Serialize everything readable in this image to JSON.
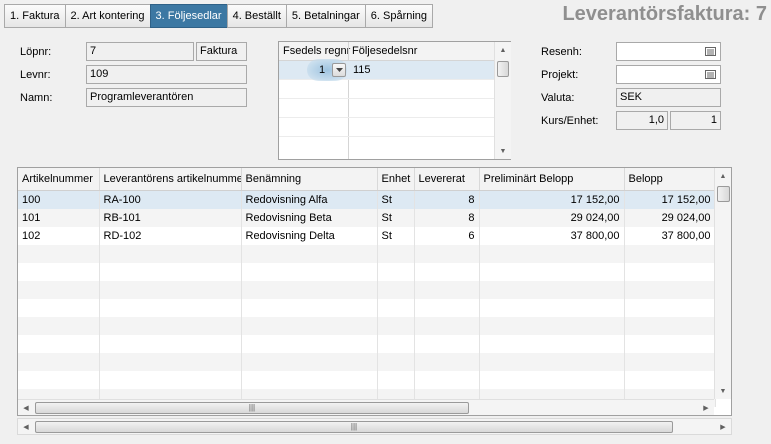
{
  "tabs": [
    {
      "label": "1. Faktura",
      "active": false
    },
    {
      "label": "2. Art kontering",
      "active": false
    },
    {
      "label": "3. Följesedlar",
      "active": true
    },
    {
      "label": "4. Beställt",
      "active": false
    },
    {
      "label": "5. Betalningar",
      "active": false
    },
    {
      "label": "6. Spårning",
      "active": false
    }
  ],
  "page_title": "Leverantörsfaktura: 7",
  "left_form": {
    "lopnr_label": "Löpnr:",
    "lopnr_value": "7",
    "type_value": "Faktura",
    "levnr_label": "Levnr:",
    "levnr_value": "109",
    "namn_label": "Namn:",
    "namn_value": "Programleverantören"
  },
  "delivery_grid": {
    "headers": [
      "Fsedels regnr",
      "Följesedelsnr"
    ],
    "rows": [
      {
        "regnr": "1",
        "number": "115"
      }
    ]
  },
  "right_form": {
    "resenh_label": "Resenh:",
    "resenh_value": "",
    "projekt_label": "Projekt:",
    "projekt_value": "",
    "valuta_label": "Valuta:",
    "valuta_value": "SEK",
    "kurs_label": "Kurs/Enhet:",
    "kurs_value": "1,0",
    "enhet_value": "1"
  },
  "items_grid": {
    "headers": [
      "Artikelnummer",
      "Leverantörens artikelnummer",
      "Benämning",
      "Enhet",
      "Levererat",
      "Preliminärt Belopp",
      "Belopp"
    ],
    "rows": [
      {
        "article": "100",
        "supplier_article": "RA-100",
        "name": "Redovisning Alfa",
        "unit": "St",
        "delivered": "8",
        "prelim": "17 152,00",
        "amount": "17 152,00"
      },
      {
        "article": "101",
        "supplier_article": "RB-101",
        "name": "Redovisning Beta",
        "unit": "St",
        "delivered": "8",
        "prelim": "29 024,00",
        "amount": "29 024,00"
      },
      {
        "article": "102",
        "supplier_article": "RD-102",
        "name": "Redovisning Delta",
        "unit": "St",
        "delivered": "6",
        "prelim": "37 800,00",
        "amount": "37 800,00"
      }
    ]
  },
  "icons": {
    "lookup": "list-lookup-icon",
    "dropdown": "chevron-down-icon"
  },
  "colors": {
    "active_tab": "#3c78a3",
    "title": "#8f8f8f",
    "selected_row": "#dde9f3"
  }
}
